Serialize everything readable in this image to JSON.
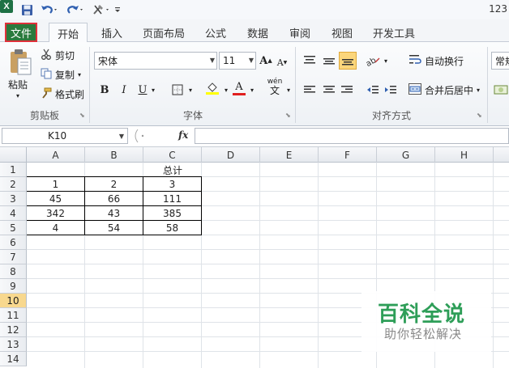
{
  "app": {
    "logo": "X",
    "title": "123"
  },
  "qat": {
    "icons": [
      "save-icon",
      "undo-icon",
      "redo-icon",
      "tools-icon",
      "customize-icon"
    ]
  },
  "tabs": [
    {
      "label": "文件"
    },
    {
      "label": "开始"
    },
    {
      "label": "插入"
    },
    {
      "label": "页面布局"
    },
    {
      "label": "公式"
    },
    {
      "label": "数据"
    },
    {
      "label": "审阅"
    },
    {
      "label": "视图"
    },
    {
      "label": "开发工具"
    }
  ],
  "ribbon": {
    "clipboard": {
      "paste": "粘贴",
      "cut": "剪切",
      "copy": "复制",
      "format_painter": "格式刷",
      "label": "剪贴板"
    },
    "font": {
      "name": "宋体",
      "size": "11",
      "bold": "B",
      "italic": "I",
      "underline": "U",
      "label": "字体",
      "grow": "A",
      "shrink": "A",
      "font_color_letter": "A",
      "wen": "wén",
      "wen_char": "文"
    },
    "align": {
      "wrap": "自动换行",
      "merge": "合并后居中",
      "label": "对齐方式"
    },
    "number": {
      "format": "常规"
    },
    "accent_color": "#2a7a3d"
  },
  "formula": {
    "name_box": "K10",
    "fx": "fx",
    "value": ""
  },
  "grid": {
    "columns": [
      "A",
      "B",
      "C",
      "D",
      "E",
      "F",
      "G",
      "H"
    ],
    "rows": [
      "1",
      "2",
      "3",
      "4",
      "5",
      "6",
      "7",
      "8",
      "9",
      "10",
      "11",
      "12",
      "13",
      "14"
    ],
    "active_row": "10",
    "cells": {
      "c1": "总计",
      "a2": "1",
      "b2": "2",
      "c2": "3",
      "a3": "45",
      "b3": "66",
      "c3": "111",
      "a4": "342",
      "b4": "43",
      "c4": "385",
      "a5": "4",
      "b5": "54",
      "c5": "58"
    }
  },
  "watermark": {
    "title": "百科全说",
    "subtitle": "助你轻松解决"
  }
}
